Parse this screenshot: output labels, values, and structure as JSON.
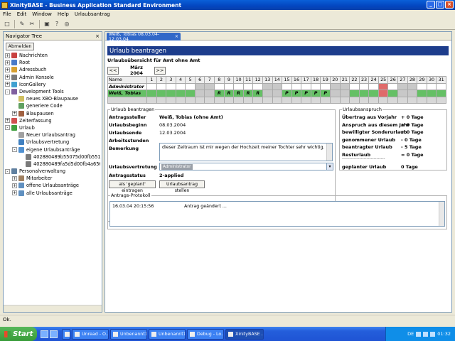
{
  "window": {
    "title": "XinityBASE - Business Application Standard Environment",
    "icons": [
      "minimize-icon",
      "maximize-icon",
      "close-icon"
    ],
    "min": "_",
    "max": "□",
    "close": "×"
  },
  "menu": [
    "File",
    "Edit",
    "Window",
    "Help",
    "Urlaubsantrag"
  ],
  "toolbar": {
    "icons": [
      "new-icon",
      "tool-icon",
      "edit-icon",
      "save-icon",
      "help-icon",
      "run-icon"
    ],
    "glyphs": [
      "□",
      "✎",
      "✂",
      "▣",
      "?",
      "◎"
    ]
  },
  "navigator": {
    "title": "Navigator Tree",
    "close": "×",
    "logout": "Abmelden",
    "tree": [
      {
        "label": "Nachrichten",
        "level": 0,
        "exp": "+"
      },
      {
        "label": "Root",
        "level": 0,
        "exp": "+"
      },
      {
        "label": "Adressbuch",
        "level": 0,
        "exp": "+"
      },
      {
        "label": "Admin Konsole",
        "level": 0,
        "exp": "+"
      },
      {
        "label": "IconGallery",
        "level": 0,
        "exp": "+"
      },
      {
        "label": "Development Tools",
        "level": 0,
        "exp": "-"
      },
      {
        "label": "neues XBO-Blaupause",
        "level": 1,
        "exp": ""
      },
      {
        "label": "generiere Code",
        "level": 1,
        "exp": ""
      },
      {
        "label": "Blaupausen",
        "level": 1,
        "exp": "+"
      },
      {
        "label": "Zeiterfassung",
        "level": 0,
        "exp": "+"
      },
      {
        "label": "Urlaub",
        "level": 0,
        "exp": "-"
      },
      {
        "label": "Neuer Urlaubsantrag",
        "level": 1,
        "exp": ""
      },
      {
        "label": "Urlaubsvertretung",
        "level": 1,
        "exp": ""
      },
      {
        "label": "eigene Urlaubsanträge",
        "level": 1,
        "exp": "-"
      },
      {
        "label": "402880489b55075d00fb5510d1",
        "level": 2,
        "exp": ""
      },
      {
        "label": "402880489fa5d5d00fb4a6562",
        "level": 2,
        "exp": ""
      },
      {
        "label": "Personalverwaltung",
        "level": 0,
        "exp": "-"
      },
      {
        "label": "Mitarbeiter",
        "level": 1,
        "exp": "+"
      },
      {
        "label": "offene Urlaubsanträge",
        "level": 1,
        "exp": "+"
      },
      {
        "label": "alle Urlaubsanträge",
        "level": 1,
        "exp": "+"
      }
    ]
  },
  "editor": {
    "tab": "Weiß, Tobias 08.03.04-12.03.04",
    "tab_close": "×",
    "heading": "Urlaub beantragen",
    "overview_label": "Urlaubsübersicht für Amt  ohne Amt",
    "prev": "<<",
    "next": ">>",
    "month": "März 2004",
    "calendar": {
      "name_header": "Name",
      "days": [
        "1",
        "2",
        "3",
        "4",
        "5",
        "6",
        "7",
        "8",
        "9",
        "10",
        "11",
        "12",
        "13",
        "14",
        "15",
        "16",
        "17",
        "18",
        "19",
        "20",
        "21",
        "22",
        "23",
        "24",
        "25",
        "26",
        "27",
        "28",
        "29",
        "30",
        "31"
      ],
      "weekends": [
        6,
        7,
        13,
        14,
        20,
        21,
        27,
        28
      ],
      "today": 25,
      "rows": [
        {
          "name": "Administrator",
          "marks": {}
        },
        {
          "name": "Weiß, Tobias",
          "marks": {
            "8": "R",
            "9": "R",
            "10": "R",
            "11": "R",
            "12": "R",
            "15": "P",
            "16": "P",
            "17": "P",
            "18": "P",
            "19": "P"
          }
        }
      ]
    }
  },
  "form": {
    "legend": "Urlaub beantragen",
    "labels": {
      "antragsteller": "Antragssteller",
      "beginn": "Urlaubsbeginn",
      "ende": "Urlaubsende",
      "arbeitstage": "Arbeitsstunden",
      "bemerkung": "Bemerkung",
      "vertretung": "Urlaubsvertretung",
      "status": "Antragsstatus"
    },
    "values": {
      "antragsteller": "Weiß, Tobias (ohne Amt)",
      "beginn": "08.03.2004",
      "ende": "12.03.2004",
      "bemerkung": "dieser Zeitraum ist mir wegen der Hochzeit meiner Tochter sehr wichtig.",
      "vertretung": "Administrator",
      "status": "2-applied"
    },
    "btn_geplant": "als 'geplant' eintragen",
    "btn_stellen": "Urlaubsantrag stellen"
  },
  "anspruch": {
    "legend": "Urlaubsanspruch",
    "rows": [
      {
        "label": "Übertrag aus Vorjahr",
        "value": "+ 0 Tage"
      },
      {
        "label": "Anspruch aus diesem Jahr",
        "value": "+ 0 Tage"
      },
      {
        "label": "bewilligter Sonderurlaub",
        "value": "+ 0 Tage"
      },
      {
        "label": "genommener Urlaub",
        "value": "- 0 Tage"
      },
      {
        "label": "beantragter Urlaub",
        "value": "- 5 Tage"
      },
      {
        "label": "Resturlaub",
        "value": "= 0 Tage"
      }
    ],
    "dashes": "------------------------------",
    "geplant_label": "geplanter Urlaub",
    "geplant_value": "0 Tage"
  },
  "protokoll": {
    "legend": "Antrags-Protokoll",
    "entries": [
      {
        "date": "16.03.04 20:15:56",
        "text": "Antrag geändert ..."
      }
    ]
  },
  "status": "Ok.",
  "taskbar": {
    "start": "Start",
    "tasks": [
      "",
      "Unread - O...",
      "Unbenannt1...",
      "Unbenannt1...",
      "Debug - Lo...",
      "XinityBASE ..."
    ],
    "active": 5,
    "lang": "DE",
    "time": "01:32"
  }
}
